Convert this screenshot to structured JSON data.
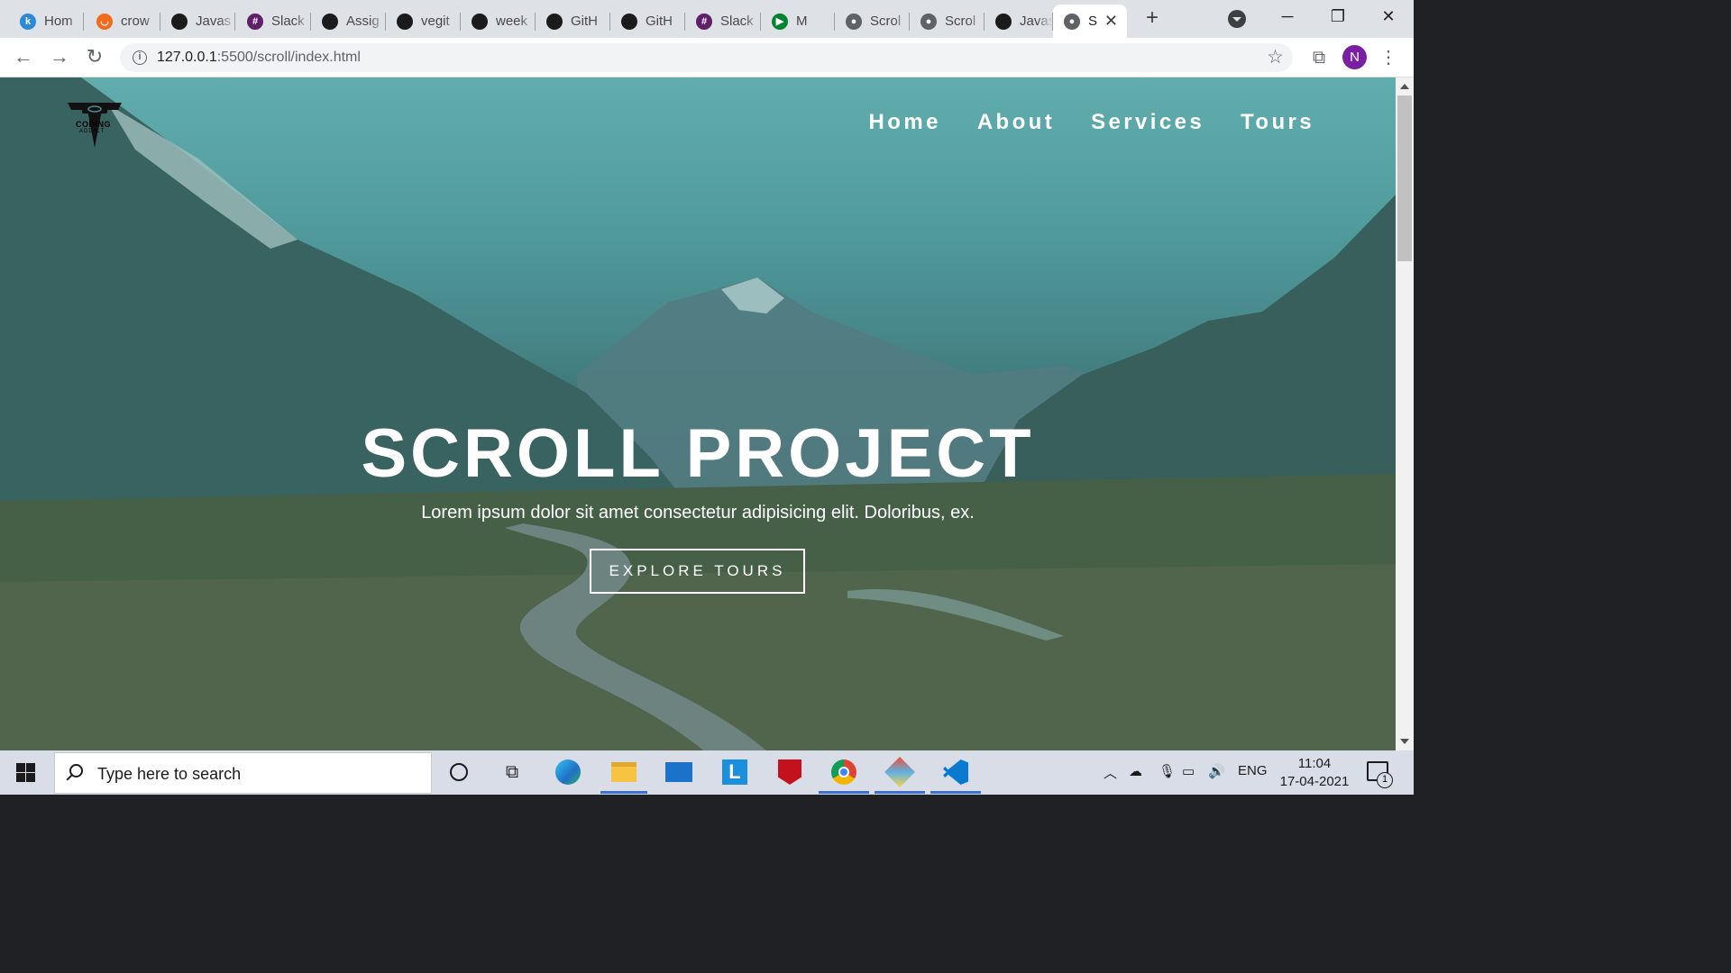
{
  "browser": {
    "tabs": [
      {
        "title": "Hom",
        "icon": "k-icon",
        "color": "#2c88d9",
        "glyph": "k"
      },
      {
        "title": "crow",
        "icon": "crowdfund-icon",
        "color": "#f26b1d",
        "glyph": "◡"
      },
      {
        "title": "Javas",
        "icon": "github-icon",
        "color": "#1b1b1b",
        "glyph": ""
      },
      {
        "title": "Slack",
        "icon": "slack-icon",
        "color": "#611f69",
        "glyph": "#"
      },
      {
        "title": "Assig",
        "icon": "github-icon",
        "color": "#1b1b1b",
        "glyph": ""
      },
      {
        "title": "vegit",
        "icon": "github-icon",
        "color": "#1b1b1b",
        "glyph": ""
      },
      {
        "title": "week",
        "icon": "github-icon",
        "color": "#1b1b1b",
        "glyph": ""
      },
      {
        "title": "GitH",
        "icon": "github-icon",
        "color": "#1b1b1b",
        "glyph": ""
      },
      {
        "title": "GitH",
        "icon": "github-icon",
        "color": "#1b1b1b",
        "glyph": ""
      },
      {
        "title": "Slack",
        "icon": "slack-icon",
        "color": "#611f69",
        "glyph": "#"
      },
      {
        "title": "M",
        "icon": "meet-icon",
        "color": "#00832d",
        "glyph": "▶"
      },
      {
        "title": "Scrol",
        "icon": "globe-icon",
        "color": "#5f6368",
        "glyph": "●"
      },
      {
        "title": "Scrol",
        "icon": "globe-icon",
        "color": "#5f6368",
        "glyph": "●"
      },
      {
        "title": "Javas",
        "icon": "github-icon",
        "color": "#1b1b1b",
        "glyph": ""
      },
      {
        "title": "S",
        "icon": "globe-icon",
        "color": "#5f6368",
        "glyph": "●",
        "active": true
      }
    ],
    "url_host": "127.0.0.1",
    "url_path": ":5500/scroll/index.html",
    "profile_initial": "N",
    "new_tab": "+",
    "tab_close": "✕",
    "window_min": "─",
    "window_restore": "❐",
    "window_close": "✕"
  },
  "page": {
    "logo_text": "CODING",
    "logo_sub": "ADDICT",
    "nav": [
      "Home",
      "About",
      "Services",
      "Tours"
    ],
    "hero_title": "SCROLL PROJECT",
    "hero_subtitle": "Lorem ipsum dolor sit amet consectetur adipisicing elit. Doloribus, ex.",
    "hero_button": "EXPLORE TOURS"
  },
  "taskbar": {
    "search_placeholder": "Type here to search",
    "language": "ENG",
    "time": "11:04",
    "date": "17-04-2021",
    "notification_count": "1"
  },
  "colors": {
    "accent": "#3a6fd8",
    "hero_tint": "#4f8b8e"
  }
}
